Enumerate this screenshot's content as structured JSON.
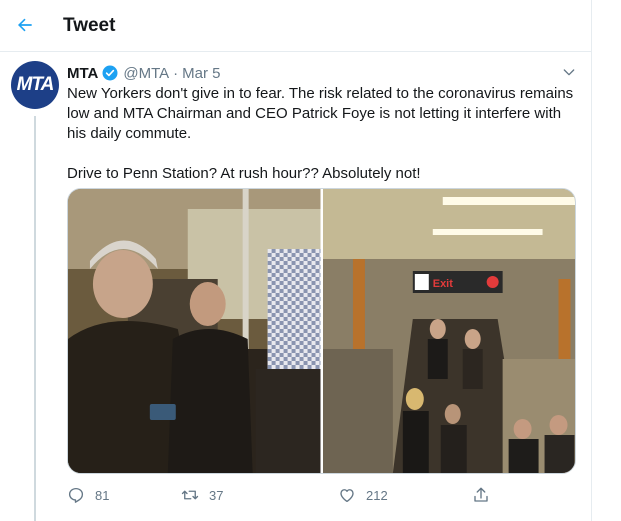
{
  "header": {
    "title": "Tweet"
  },
  "tweet": {
    "avatar_text": "MTA",
    "display_name": "MTA",
    "handle": "@MTA",
    "separator": "·",
    "date": "Mar 5",
    "text_line1": "New Yorkers don't give in to fear. The risk related to the coronavirus remains low and MTA Chairman and CEO Patrick Foye is not letting it interfere with his daily commute.",
    "text_line2": "Drive to Penn Station? At rush hour?? Absolutely not!",
    "replies": "81",
    "retweets": "37",
    "likes": "212"
  },
  "photos": [
    {
      "description": "subway-car-photo"
    },
    {
      "description": "penn-station-stairway-photo",
      "sign_text": "Exit"
    }
  ],
  "colors": {
    "accent": "#1da1f2",
    "avatar_bg": "#1d3f87",
    "muted": "#657786",
    "text": "#14171a",
    "divider": "#e6ecf0"
  },
  "icons": {
    "back": "arrow-left-icon",
    "verified": "verified-badge-icon",
    "caret": "chevron-down-icon",
    "reply": "reply-icon",
    "retweet": "retweet-icon",
    "like": "heart-icon",
    "share": "share-icon"
  }
}
